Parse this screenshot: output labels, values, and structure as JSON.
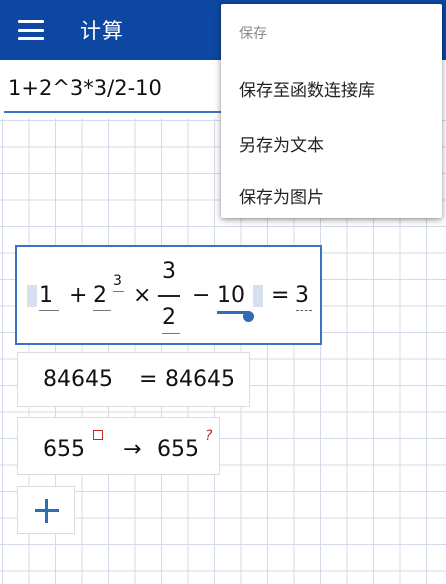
{
  "app_bar": {
    "title": "计算",
    "background": "#0d47a1"
  },
  "input": {
    "value": "1+2^3*3/2-10"
  },
  "save_menu": {
    "header": "保存",
    "items": [
      {
        "label": "保存至函数连接库"
      },
      {
        "label": "另存为文本"
      },
      {
        "label": "保存为图片"
      }
    ]
  },
  "results": [
    {
      "terms": {
        "t1": "1",
        "plus": "+",
        "base": "2",
        "exponent": "3",
        "times": "×",
        "numerator": "3",
        "denominator": "2",
        "minus": "−",
        "t4": "10",
        "equals": "=",
        "result": "3"
      }
    },
    {
      "expression": "84645",
      "equals": "=",
      "result": "84645"
    },
    {
      "expression": "655",
      "arrow": "→",
      "result": "655",
      "result_suffix": "?"
    }
  ],
  "icons": {
    "menu": "hamburger-menu-icon",
    "add": "plus-icon",
    "placeholder": "empty-square-icon"
  },
  "colors": {
    "accent": "#2f6db8",
    "error": "#c62828"
  }
}
